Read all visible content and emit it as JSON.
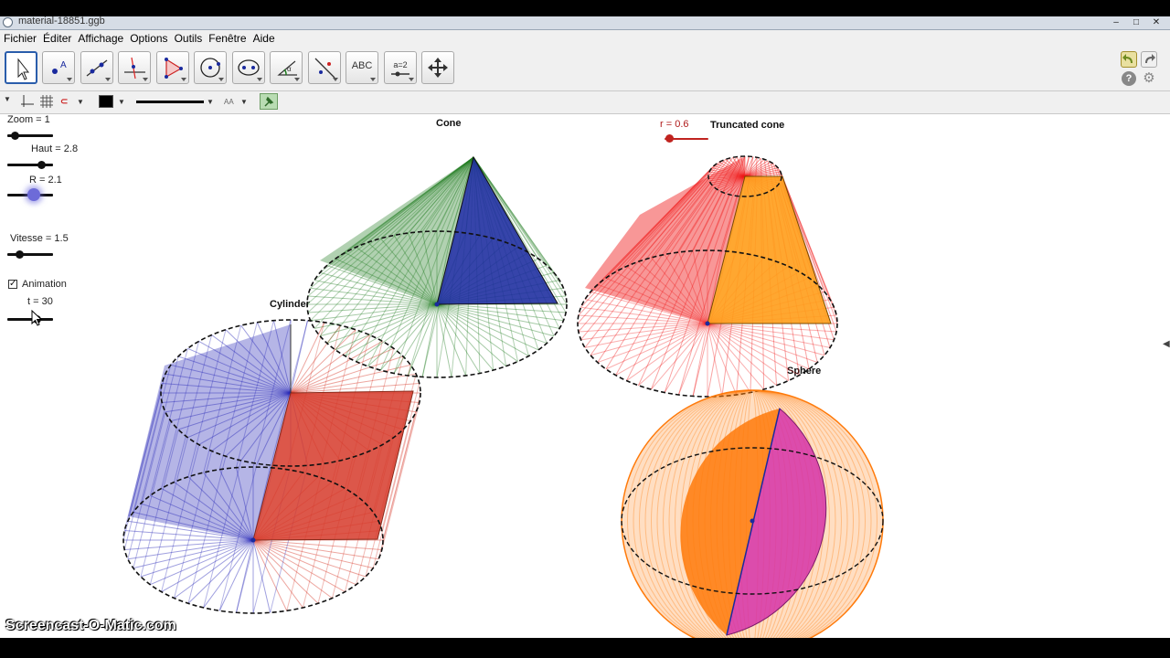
{
  "window": {
    "title": "material-18851.ggb"
  },
  "menu": [
    "Fichier",
    "Éditer",
    "Affichage",
    "Options",
    "Outils",
    "Fenêtre",
    "Aide"
  ],
  "toolbar": {
    "tools": [
      "move-tool",
      "point-tool",
      "line-tool",
      "perpendicular-tool",
      "polygon-tool",
      "circle-tool",
      "conic-tool",
      "angle-tool",
      "reflect-tool",
      "text-tool",
      "slider-tool",
      "move-view-tool"
    ],
    "text_tool_label": "ABC",
    "slider_tool_label": "a=2"
  },
  "sliders": {
    "zoom": {
      "label": "Zoom = 1",
      "value": 1
    },
    "haut": {
      "label": "Haut = 2.8",
      "value": 2.8
    },
    "radius": {
      "label": "R = 2.1",
      "value": 2.1
    },
    "vitesse": {
      "label": "Vitesse = 1.5",
      "value": 1.5
    },
    "t": {
      "label": "t = 30",
      "value": 30
    },
    "r": {
      "label": "r = 0.6",
      "value": 0.6
    }
  },
  "animation": {
    "label": "Animation",
    "checked": true,
    "mark": "✓"
  },
  "shapes": {
    "cone": "Cone",
    "truncated_cone": "Truncated cone",
    "cylinder": "Cylinder",
    "sphere": "Sphere"
  },
  "colors": {
    "cylinder_blue": "#2b2bb8",
    "cylinder_red": "#d63a2a",
    "cone_green": "#1f7a1f",
    "cone_blue": "#1a2a9e",
    "truncated_red": "#f01818",
    "truncated_orange": "#ff9d1a",
    "sphere_orange": "#ff7a0a",
    "sphere_magenta": "#d633a8"
  },
  "watermark": "Screencast-O-Matic.com"
}
